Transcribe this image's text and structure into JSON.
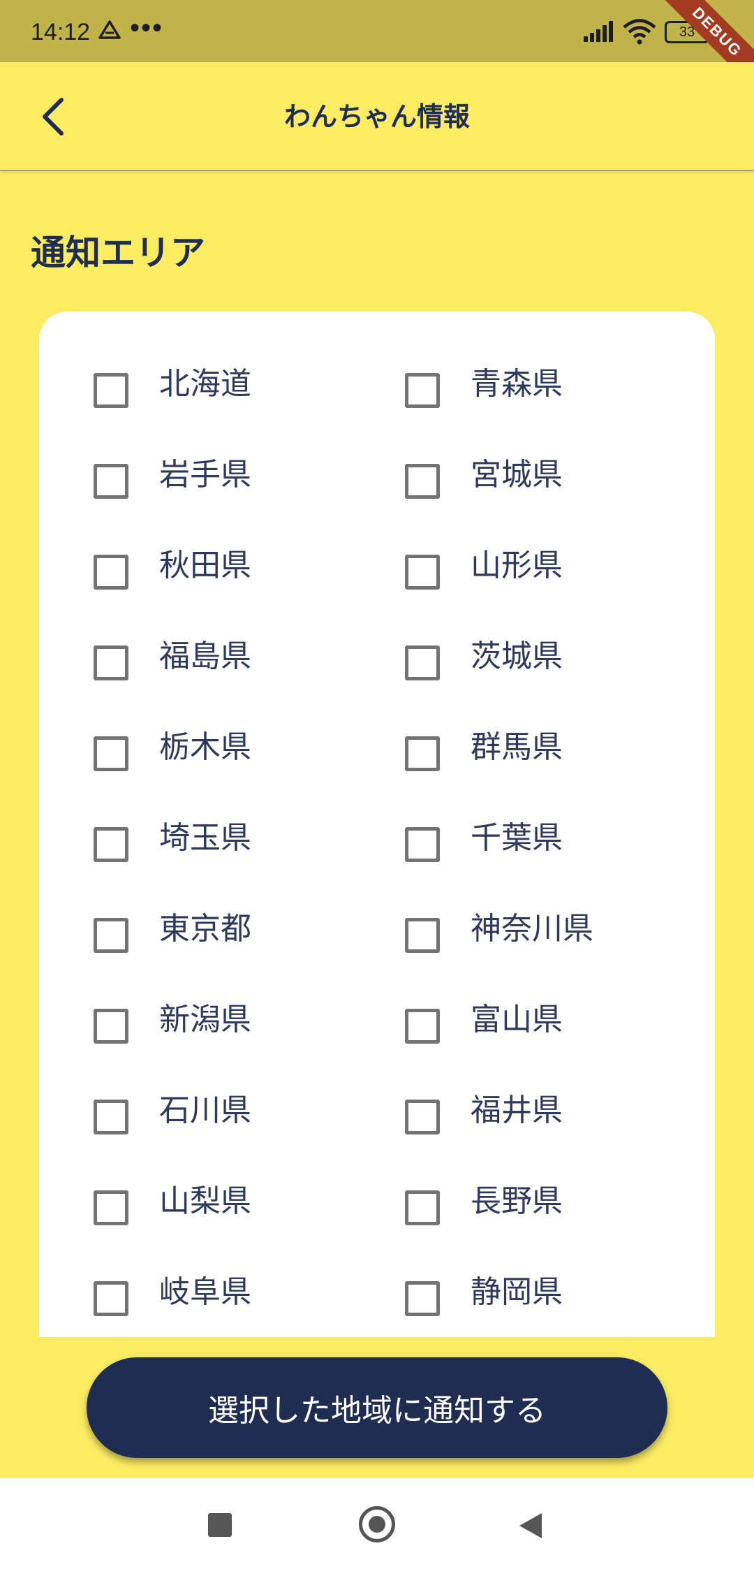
{
  "status_bar": {
    "time": "14:12",
    "dots": "•••",
    "battery": "33",
    "debug_label": "DEBUG"
  },
  "app_bar": {
    "title": "わんちゃん情報",
    "back_icon": "chevron-left-icon"
  },
  "section": {
    "title": "通知エリア"
  },
  "prefectures": [
    {
      "name": "北海道",
      "checked": false
    },
    {
      "name": "青森県",
      "checked": false
    },
    {
      "name": "岩手県",
      "checked": false
    },
    {
      "name": "宮城県",
      "checked": false
    },
    {
      "name": "秋田県",
      "checked": false
    },
    {
      "name": "山形県",
      "checked": false
    },
    {
      "name": "福島県",
      "checked": false
    },
    {
      "name": "茨城県",
      "checked": false
    },
    {
      "name": "栃木県",
      "checked": false
    },
    {
      "name": "群馬県",
      "checked": false
    },
    {
      "name": "埼玉県",
      "checked": false
    },
    {
      "name": "千葉県",
      "checked": false
    },
    {
      "name": "東京都",
      "checked": false
    },
    {
      "name": "神奈川県",
      "checked": false
    },
    {
      "name": "新潟県",
      "checked": false
    },
    {
      "name": "富山県",
      "checked": false
    },
    {
      "name": "石川県",
      "checked": false
    },
    {
      "name": "福井県",
      "checked": false
    },
    {
      "name": "山梨県",
      "checked": false
    },
    {
      "name": "長野県",
      "checked": false
    },
    {
      "name": "岐阜県",
      "checked": false
    },
    {
      "name": "静岡県",
      "checked": false
    }
  ],
  "notify_button": {
    "label": "選択した地域に通知する"
  },
  "colors": {
    "background": "#FCEC63",
    "status_bar": "#BFB34A",
    "primary": "#1F2D52",
    "card": "#FFFFFF"
  }
}
